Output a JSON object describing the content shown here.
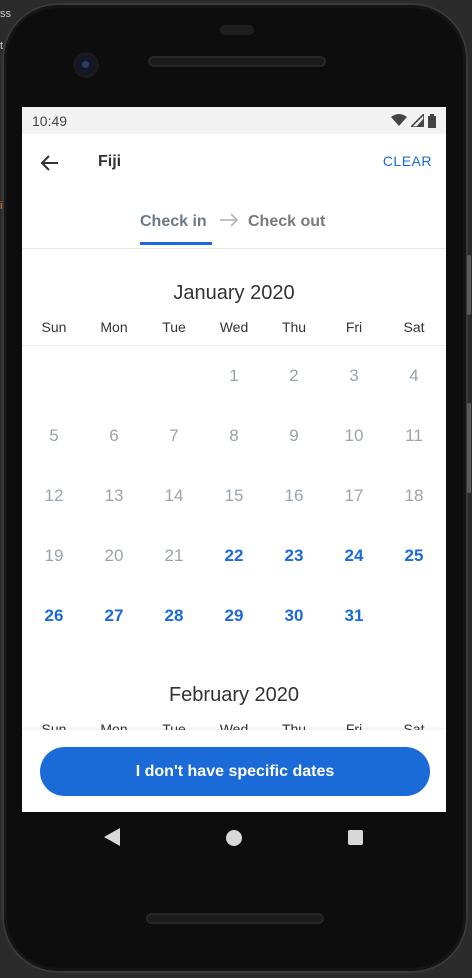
{
  "status": {
    "time": "10:49"
  },
  "appbar": {
    "title": "Fiji",
    "clear_label": "CLEAR"
  },
  "tabs": {
    "check_in": "Check in",
    "check_out": "Check out"
  },
  "weekdays": [
    "Sun",
    "Mon",
    "Tue",
    "Wed",
    "Thu",
    "Fri",
    "Sat"
  ],
  "months": [
    {
      "title": "January 2020",
      "leading_blanks": 3,
      "days": [
        {
          "d": "1",
          "state": "past"
        },
        {
          "d": "2",
          "state": "past"
        },
        {
          "d": "3",
          "state": "past"
        },
        {
          "d": "4",
          "state": "past"
        },
        {
          "d": "5",
          "state": "past"
        },
        {
          "d": "6",
          "state": "past"
        },
        {
          "d": "7",
          "state": "past"
        },
        {
          "d": "8",
          "state": "past"
        },
        {
          "d": "9",
          "state": "past"
        },
        {
          "d": "10",
          "state": "past"
        },
        {
          "d": "11",
          "state": "past"
        },
        {
          "d": "12",
          "state": "past"
        },
        {
          "d": "13",
          "state": "past"
        },
        {
          "d": "14",
          "state": "past"
        },
        {
          "d": "15",
          "state": "past"
        },
        {
          "d": "16",
          "state": "past"
        },
        {
          "d": "17",
          "state": "past"
        },
        {
          "d": "18",
          "state": "past"
        },
        {
          "d": "19",
          "state": "past"
        },
        {
          "d": "20",
          "state": "past"
        },
        {
          "d": "21",
          "state": "past"
        },
        {
          "d": "22",
          "state": "avail"
        },
        {
          "d": "23",
          "state": "avail"
        },
        {
          "d": "24",
          "state": "avail"
        },
        {
          "d": "25",
          "state": "avail"
        },
        {
          "d": "26",
          "state": "avail"
        },
        {
          "d": "27",
          "state": "avail"
        },
        {
          "d": "28",
          "state": "avail"
        },
        {
          "d": "29",
          "state": "avail"
        },
        {
          "d": "30",
          "state": "avail"
        },
        {
          "d": "31",
          "state": "avail"
        }
      ]
    },
    {
      "title": "February 2020"
    }
  ],
  "cta": {
    "label": "I don't have specific dates"
  },
  "edge": {
    "t1": "ss",
    "t2": "t",
    "t3": "i"
  },
  "colors": {
    "accent": "#1a6ad8",
    "past_day": "#9aa3aa"
  },
  "icons": {
    "back": "arrow-left-icon",
    "tab_arrow": "arrow-right-icon"
  }
}
